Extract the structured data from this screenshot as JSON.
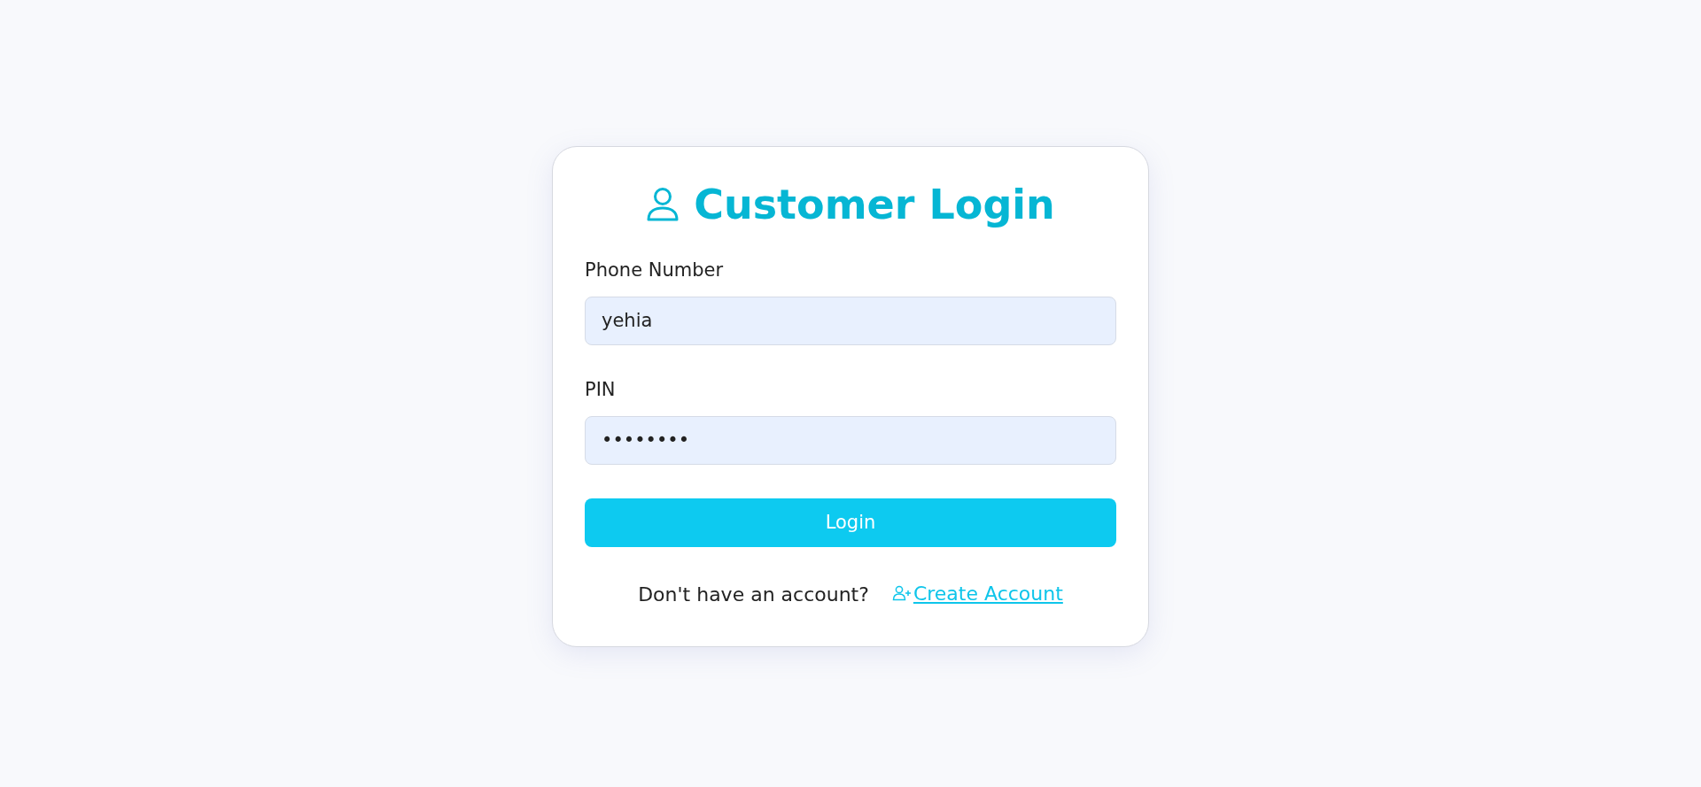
{
  "title": "Customer Login",
  "fields": [
    {
      "label": "Phone Number",
      "value": "yehia"
    },
    {
      "label": "PIN",
      "value": "••••••••"
    }
  ],
  "login_button": "Login",
  "footer": {
    "prompt": "Don't have an account?",
    "link": "Create Account"
  }
}
